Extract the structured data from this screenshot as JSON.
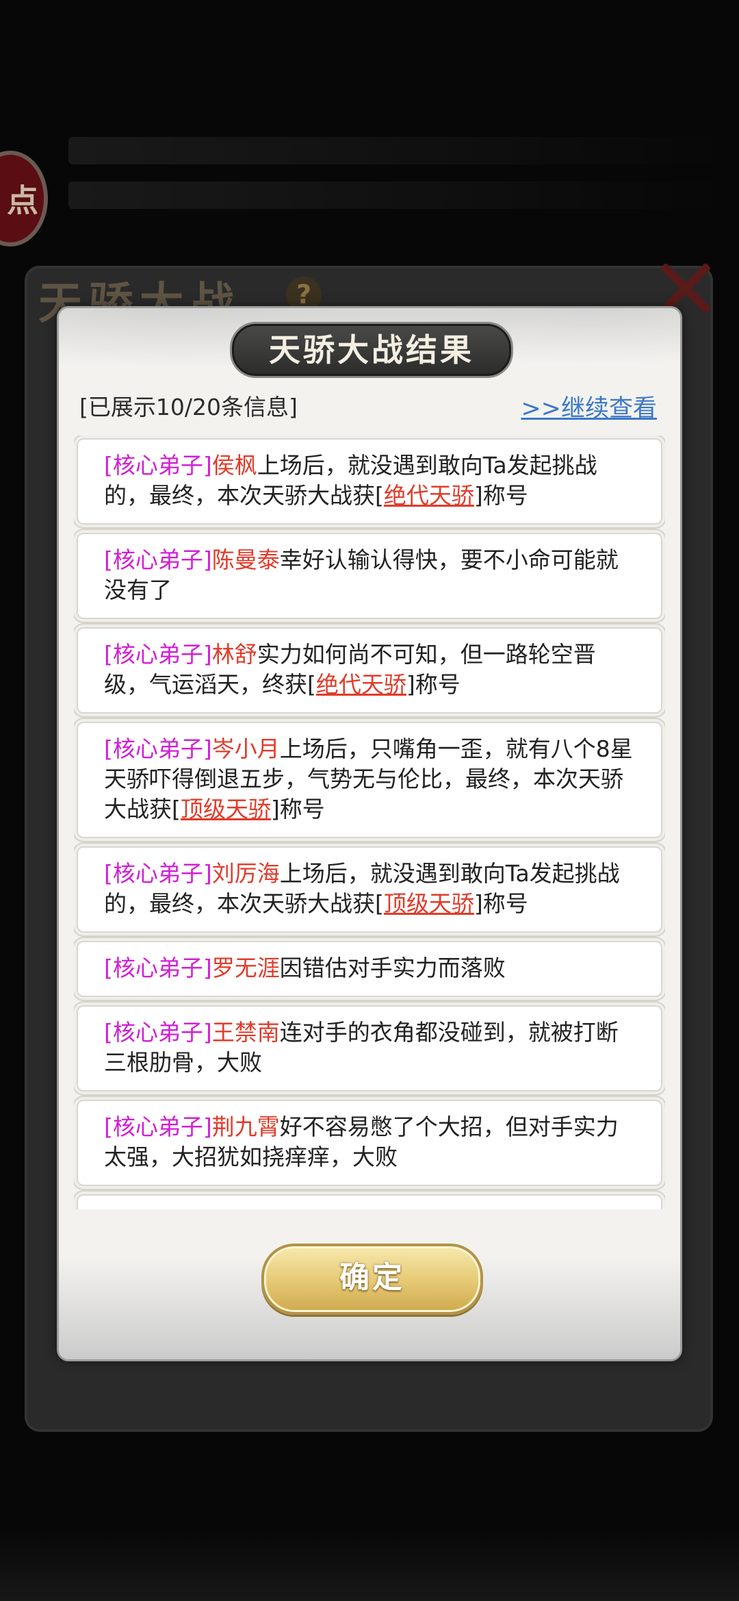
{
  "background": {
    "title": "天骄大战",
    "help_glyph": "?",
    "side_badge": "点"
  },
  "dialog": {
    "title": "天骄大战结果",
    "info_count": "[已展示10/20条信息]",
    "more_link": ">>继续查看",
    "confirm_label": "确定",
    "entries": [
      {
        "tag": "[核心弟子]",
        "name": "侯枫",
        "text": "上场后，就没遇到敢向Ta发起挑战的，最终，本次天骄大战获",
        "title": "绝代天骄",
        "suffix": "称号"
      },
      {
        "tag": "[核心弟子]",
        "name": "陈曼泰",
        "text": "幸好认输认得快，要不小命可能就没有了",
        "title": "",
        "suffix": ""
      },
      {
        "tag": "[核心弟子]",
        "name": "林舒",
        "text": "实力如何尚不可知，但一路轮空晋级，气运滔天，终获",
        "title": "绝代天骄",
        "suffix": "称号"
      },
      {
        "tag": "[核心弟子]",
        "name": "岑小月",
        "text": "上场后，只嘴角一歪，就有八个8星天骄吓得倒退五步，气势无与伦比，最终，本次天骄大战获",
        "title": "顶级天骄",
        "suffix": "称号"
      },
      {
        "tag": "[核心弟子]",
        "name": "刘厉海",
        "text": "上场后，就没遇到敢向Ta发起挑战的，最终，本次天骄大战获",
        "title": "顶级天骄",
        "suffix": "称号"
      },
      {
        "tag": "[核心弟子]",
        "name": "罗无涯",
        "text": "因错估对手实力而落败",
        "title": "",
        "suffix": ""
      },
      {
        "tag": "[核心弟子]",
        "name": "王禁南",
        "text": "连对手的衣角都没碰到，就被打断三根肋骨，大败",
        "title": "",
        "suffix": ""
      },
      {
        "tag": "[核心弟子]",
        "name": "荆九霄",
        "text": "好不容易憋了个大招，但对手实力太强，大招犹如挠痒痒，大败",
        "title": "",
        "suffix": ""
      }
    ]
  },
  "colors": {
    "tag": "#d21fd4",
    "name": "#e23b2a",
    "link": "#3a78c9",
    "button_gold": "#e5c873"
  }
}
